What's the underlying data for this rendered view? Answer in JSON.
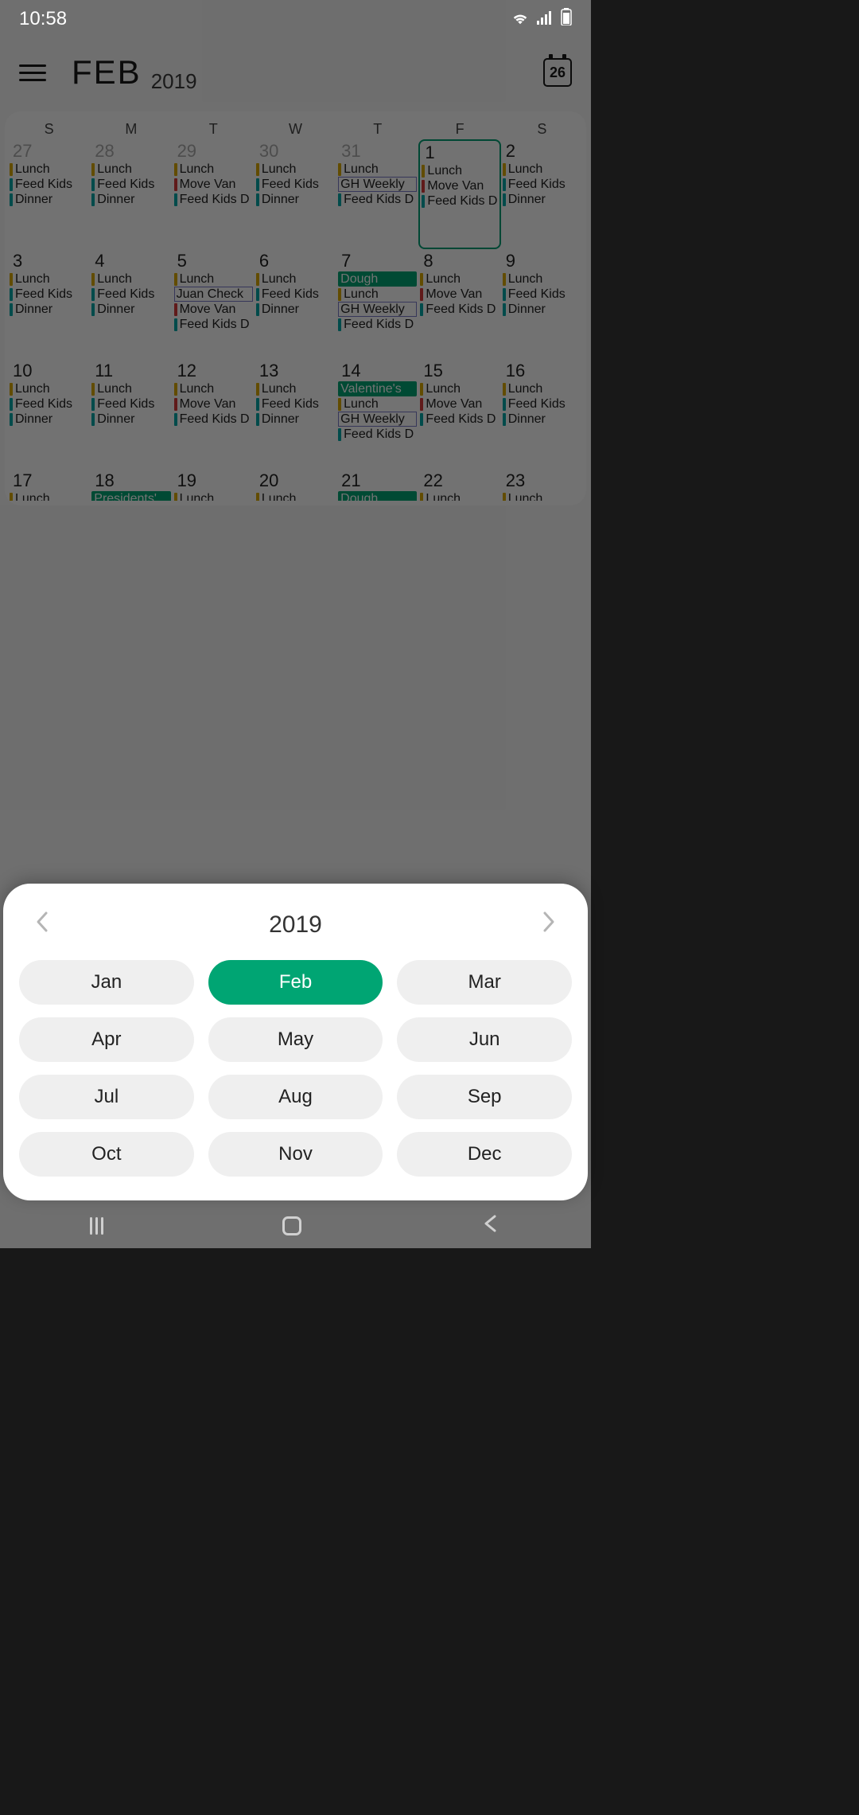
{
  "status": {
    "time": "10:58"
  },
  "header": {
    "month": "FEB",
    "year": "2019",
    "today_badge": "26"
  },
  "dow": [
    "S",
    "M",
    "T",
    "W",
    "T",
    "F",
    "S"
  ],
  "colors": {
    "lunch": "c-yellow",
    "feed": "c-teal",
    "dinner": "c-teal",
    "move": "c-red",
    "weekly": "c-teal",
    "dough": "c-green",
    "val": "c-green",
    "pres": "c-green",
    "juan": "c-teal"
  },
  "weeks": [
    [
      {
        "n": "27",
        "out": true,
        "ev": [
          {
            "t": "Lunch",
            "s": "bar",
            "c": "lunch"
          },
          {
            "t": "Feed Kids",
            "s": "bar",
            "c": "feed"
          },
          {
            "t": "Dinner",
            "s": "bar",
            "c": "dinner"
          }
        ]
      },
      {
        "n": "28",
        "out": true,
        "ev": [
          {
            "t": "Lunch",
            "s": "bar",
            "c": "lunch"
          },
          {
            "t": "Feed Kids",
            "s": "bar",
            "c": "feed"
          },
          {
            "t": "Dinner",
            "s": "bar",
            "c": "dinner"
          }
        ]
      },
      {
        "n": "29",
        "out": true,
        "ev": [
          {
            "t": "Lunch",
            "s": "bar",
            "c": "lunch"
          },
          {
            "t": "Move Van",
            "s": "bar",
            "c": "move"
          },
          {
            "t": "Feed Kids D",
            "s": "bar",
            "c": "feed"
          }
        ]
      },
      {
        "n": "30",
        "out": true,
        "ev": [
          {
            "t": "Lunch",
            "s": "bar",
            "c": "lunch"
          },
          {
            "t": "Feed Kids",
            "s": "bar",
            "c": "feed"
          },
          {
            "t": "Dinner",
            "s": "bar",
            "c": "dinner"
          }
        ]
      },
      {
        "n": "31",
        "out": true,
        "ev": [
          {
            "t": "Lunch",
            "s": "bar",
            "c": "lunch"
          },
          {
            "t": "GH Weekly",
            "s": "box"
          },
          {
            "t": "Feed Kids D",
            "s": "bar",
            "c": "feed"
          }
        ]
      },
      {
        "n": "1",
        "sel": true,
        "ev": [
          {
            "t": "Lunch",
            "s": "bar",
            "c": "lunch"
          },
          {
            "t": "Move Van",
            "s": "bar",
            "c": "move"
          },
          {
            "t": "Feed Kids D",
            "s": "bar",
            "c": "feed"
          }
        ]
      },
      {
        "n": "2",
        "ev": [
          {
            "t": "Lunch",
            "s": "bar",
            "c": "lunch"
          },
          {
            "t": "Feed Kids",
            "s": "bar",
            "c": "feed"
          },
          {
            "t": "Dinner",
            "s": "bar",
            "c": "dinner"
          }
        ]
      }
    ],
    [
      {
        "n": "3",
        "ev": [
          {
            "t": "Lunch",
            "s": "bar",
            "c": "lunch"
          },
          {
            "t": "Feed Kids",
            "s": "bar",
            "c": "feed"
          },
          {
            "t": "Dinner",
            "s": "bar",
            "c": "dinner"
          }
        ]
      },
      {
        "n": "4",
        "ev": [
          {
            "t": "Lunch",
            "s": "bar",
            "c": "lunch"
          },
          {
            "t": "Feed Kids",
            "s": "bar",
            "c": "feed"
          },
          {
            "t": "Dinner",
            "s": "bar",
            "c": "dinner"
          }
        ]
      },
      {
        "n": "5",
        "ev": [
          {
            "t": "Lunch",
            "s": "bar",
            "c": "lunch"
          },
          {
            "t": "Juan Check",
            "s": "box"
          },
          {
            "t": "Move Van",
            "s": "bar",
            "c": "move"
          },
          {
            "t": "Feed Kids D",
            "s": "bar",
            "c": "feed"
          }
        ]
      },
      {
        "n": "6",
        "ev": [
          {
            "t": "Lunch",
            "s": "bar",
            "c": "lunch"
          },
          {
            "t": "Feed Kids",
            "s": "bar",
            "c": "feed"
          },
          {
            "t": "Dinner",
            "s": "bar",
            "c": "dinner"
          }
        ]
      },
      {
        "n": "7",
        "ev": [
          {
            "t": "Dough",
            "s": "solid"
          },
          {
            "t": "Lunch",
            "s": "bar",
            "c": "lunch"
          },
          {
            "t": "GH Weekly",
            "s": "box"
          },
          {
            "t": "Feed Kids D",
            "s": "bar",
            "c": "feed"
          }
        ]
      },
      {
        "n": "8",
        "ev": [
          {
            "t": "Lunch",
            "s": "bar",
            "c": "lunch"
          },
          {
            "t": "Move Van",
            "s": "bar",
            "c": "move"
          },
          {
            "t": "Feed Kids D",
            "s": "bar",
            "c": "feed"
          }
        ]
      },
      {
        "n": "9",
        "ev": [
          {
            "t": "Lunch",
            "s": "bar",
            "c": "lunch"
          },
          {
            "t": "Feed Kids",
            "s": "bar",
            "c": "feed"
          },
          {
            "t": "Dinner",
            "s": "bar",
            "c": "dinner"
          }
        ]
      }
    ],
    [
      {
        "n": "10",
        "ev": [
          {
            "t": "Lunch",
            "s": "bar",
            "c": "lunch"
          },
          {
            "t": "Feed Kids",
            "s": "bar",
            "c": "feed"
          },
          {
            "t": "Dinner",
            "s": "bar",
            "c": "dinner"
          }
        ]
      },
      {
        "n": "11",
        "ev": [
          {
            "t": "Lunch",
            "s": "bar",
            "c": "lunch"
          },
          {
            "t": "Feed Kids",
            "s": "bar",
            "c": "feed"
          },
          {
            "t": "Dinner",
            "s": "bar",
            "c": "dinner"
          }
        ]
      },
      {
        "n": "12",
        "ev": [
          {
            "t": "Lunch",
            "s": "bar",
            "c": "lunch"
          },
          {
            "t": "Move Van",
            "s": "bar",
            "c": "move"
          },
          {
            "t": "Feed Kids D",
            "s": "bar",
            "c": "feed"
          }
        ]
      },
      {
        "n": "13",
        "ev": [
          {
            "t": "Lunch",
            "s": "bar",
            "c": "lunch"
          },
          {
            "t": "Feed Kids",
            "s": "bar",
            "c": "feed"
          },
          {
            "t": "Dinner",
            "s": "bar",
            "c": "dinner"
          }
        ]
      },
      {
        "n": "14",
        "ev": [
          {
            "t": "Valentine's",
            "s": "solid"
          },
          {
            "t": "Lunch",
            "s": "bar",
            "c": "lunch"
          },
          {
            "t": "GH Weekly",
            "s": "box"
          },
          {
            "t": "Feed Kids D",
            "s": "bar",
            "c": "feed"
          }
        ]
      },
      {
        "n": "15",
        "ev": [
          {
            "t": "Lunch",
            "s": "bar",
            "c": "lunch"
          },
          {
            "t": "Move Van",
            "s": "bar",
            "c": "move"
          },
          {
            "t": "Feed Kids D",
            "s": "bar",
            "c": "feed"
          }
        ]
      },
      {
        "n": "16",
        "ev": [
          {
            "t": "Lunch",
            "s": "bar",
            "c": "lunch"
          },
          {
            "t": "Feed Kids",
            "s": "bar",
            "c": "feed"
          },
          {
            "t": "Dinner",
            "s": "bar",
            "c": "dinner"
          }
        ]
      }
    ],
    [
      {
        "n": "17",
        "ev": [
          {
            "t": "Lunch",
            "s": "bar",
            "c": "lunch"
          }
        ]
      },
      {
        "n": "18",
        "ev": [
          {
            "t": "Presidents'",
            "s": "solid"
          }
        ]
      },
      {
        "n": "19",
        "ev": [
          {
            "t": "Lunch",
            "s": "bar",
            "c": "lunch"
          }
        ]
      },
      {
        "n": "20",
        "ev": [
          {
            "t": "Lunch",
            "s": "bar",
            "c": "lunch"
          }
        ]
      },
      {
        "n": "21",
        "ev": [
          {
            "t": "Dough",
            "s": "solid"
          }
        ]
      },
      {
        "n": "22",
        "ev": [
          {
            "t": "Lunch",
            "s": "bar",
            "c": "lunch"
          }
        ]
      },
      {
        "n": "23",
        "ev": [
          {
            "t": "Lunch",
            "s": "bar",
            "c": "lunch"
          }
        ]
      }
    ]
  ],
  "picker": {
    "year": "2019",
    "months": [
      "Jan",
      "Feb",
      "Mar",
      "Apr",
      "May",
      "Jun",
      "Jul",
      "Aug",
      "Sep",
      "Oct",
      "Nov",
      "Dec"
    ],
    "selected": 1
  }
}
